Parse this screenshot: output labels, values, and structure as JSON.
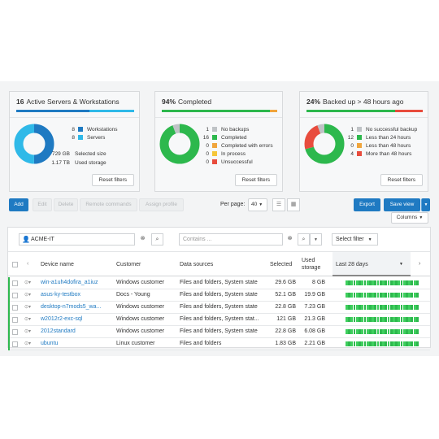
{
  "cards": [
    {
      "count": "16",
      "title": "Active Servers & Workstations",
      "bar": [
        {
          "color": "#1f7ac2",
          "share": 0.62
        },
        {
          "color": "#2fb9e8",
          "share": 0.38
        }
      ],
      "donut": [
        {
          "value": 8,
          "color": "#1f7ac2"
        },
        {
          "value": 8,
          "color": "#2fb9e8"
        }
      ],
      "legend": [
        {
          "num": "8",
          "label": "Workstations",
          "color": "#1f7ac2"
        },
        {
          "num": "8",
          "label": "Servers",
          "color": "#2fb9e8"
        }
      ],
      "stats": [
        {
          "value": "729 GB",
          "label": "Selected size"
        },
        {
          "value": "1.17 TB",
          "label": "Used storage"
        }
      ],
      "reset": "Reset filters"
    },
    {
      "count": "94%",
      "title": "Completed",
      "bar": [
        {
          "color": "#2db84d",
          "share": 0.94
        },
        {
          "color": "#f0a53c",
          "share": 0.06
        }
      ],
      "donut": [
        {
          "value": 16,
          "color": "#2db84d"
        },
        {
          "value": 1,
          "color": "#bfc3c6"
        }
      ],
      "legend": [
        {
          "num": "1",
          "label": "No backups",
          "color": "#bfc3c6"
        },
        {
          "num": "16",
          "label": "Completed",
          "color": "#2db84d"
        },
        {
          "num": "0",
          "label": "Completed with errors",
          "color": "#f0a53c"
        },
        {
          "num": "0",
          "label": "In process",
          "color": "#f5c63a"
        },
        {
          "num": "0",
          "label": "Unsuccessful",
          "color": "#e84c3d"
        }
      ],
      "reset": "Reset filters"
    },
    {
      "count": "24%",
      "title": "Backed up > 48 hours ago",
      "bar": [
        {
          "color": "#2db84d",
          "share": 0.76
        },
        {
          "color": "#e84c3d",
          "share": 0.24
        }
      ],
      "donut": [
        {
          "value": 12,
          "color": "#2db84d"
        },
        {
          "value": 4,
          "color": "#e84c3d"
        },
        {
          "value": 1,
          "color": "#bfc3c6"
        }
      ],
      "legend": [
        {
          "num": "1",
          "label": "No successful backup",
          "color": "#bfc3c6"
        },
        {
          "num": "12",
          "label": "Less than 24 hours",
          "color": "#2db84d"
        },
        {
          "num": "0",
          "label": "Less than 48 hours",
          "color": "#f0a53c"
        },
        {
          "num": "4",
          "label": "More than 48 hours",
          "color": "#e84c3d"
        }
      ],
      "reset": "Reset filters"
    }
  ],
  "toolbar": {
    "add": "Add",
    "edit": "Edit",
    "delete": "Delete",
    "remote": "Remote commands",
    "assign": "Assign profile",
    "per_page_label": "Per page:",
    "per_page_value": "40",
    "export": "Export",
    "save_view": "Save view",
    "columns": "Columns"
  },
  "filters": {
    "customer": "ACME-IT",
    "contains_placeholder": "Contains ...",
    "select_filter": "Select filter"
  },
  "table": {
    "headers": {
      "device": "Device name",
      "customer": "Customer",
      "sources": "Data sources",
      "selected": "Selected",
      "used": "Used storage",
      "last28": "Last 28 days"
    },
    "rows": [
      {
        "device": "win-a1uh4dofira_a1iuz",
        "customer": "Windows customer",
        "sources": "Files and folders, System state",
        "selected": "29.6 GB",
        "used": "8 GB"
      },
      {
        "device": "asus-ky-testbox",
        "customer": "Docs - Young",
        "sources": "Files and folders, System state",
        "selected": "52.1 GB",
        "used": "19.9 GB"
      },
      {
        "device": "desktop-n7mods5_wa...",
        "customer": "Windows customer",
        "sources": "Files and folders, System state",
        "selected": "22.8 GB",
        "used": "7.23 GB"
      },
      {
        "device": "w2012r2-exc-sql",
        "customer": "Windows customer",
        "sources": "Files and folders, System stat...",
        "selected": "121 GB",
        "used": "21.3 GB"
      },
      {
        "device": "2012standard",
        "customer": "Windows customer",
        "sources": "Files and folders, System state",
        "selected": "22.8 GB",
        "used": "6.08 GB"
      },
      {
        "device": "ubuntu",
        "customer": "Linux customer",
        "sources": "Files and folders",
        "selected": "1.83 GB",
        "used": "2.21 GB"
      }
    ]
  }
}
